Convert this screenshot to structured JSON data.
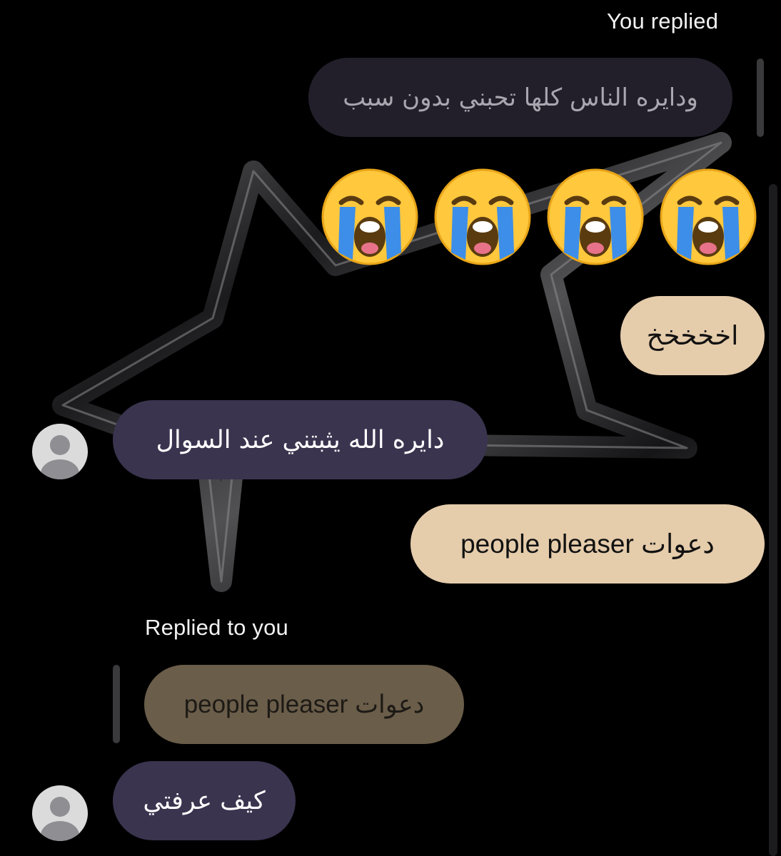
{
  "thread": {
    "you_replied_caption": "You replied",
    "replied_to_you_caption": "Replied to you"
  },
  "messages": [
    {
      "kind": "quoted_outgoing",
      "text": "ودايره الناس كلها تحبني بدون سبب"
    },
    {
      "kind": "emoji",
      "emoji": "loudly-crying-face",
      "count": 4
    },
    {
      "kind": "outgoing",
      "text": "اخخخخخ"
    },
    {
      "kind": "incoming",
      "text": "دايره الله يثبتني عند السوال"
    },
    {
      "kind": "outgoing",
      "text": "دعوات people pleaser"
    },
    {
      "kind": "quoted_incoming",
      "text": "دعوات people pleaser"
    },
    {
      "kind": "incoming",
      "text": "كيف عرفتي"
    }
  ],
  "colors": {
    "background": "#000000",
    "incoming_bubble": "#3a344f",
    "outgoing_bubble": "#e5ccab",
    "quoted_outgoing_bubble": "#221f2b",
    "quoted_incoming_bubble": "#6a5d49",
    "emoji_face": "#ffc83d",
    "tear_blue": "#3d8ee8"
  },
  "icons": {
    "avatar": "default-avatar-icon",
    "background_art": "chrome-star-wallpaper"
  }
}
